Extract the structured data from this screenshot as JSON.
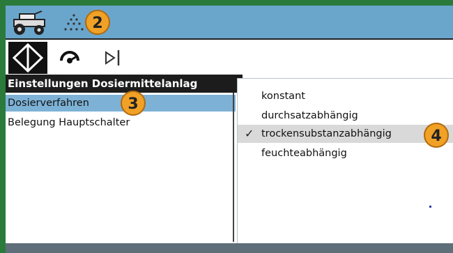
{
  "callouts": {
    "c2": "2",
    "c3": "3",
    "c4": "4"
  },
  "menu": {
    "title": "Einstellungen Dosiermittelanlag",
    "items": [
      {
        "label": "Dosierverfahren",
        "selected": true
      },
      {
        "label": "Belegung Hauptschalter",
        "selected": false
      }
    ]
  },
  "dropdown": {
    "options": [
      {
        "label": "konstant",
        "checked": false
      },
      {
        "label": "durchsatzabhängig",
        "checked": false
      },
      {
        "label": "trockensubstanzabhängig",
        "checked": true
      },
      {
        "label": "feuchteabhängig",
        "checked": false
      }
    ],
    "check_glyph": "✓"
  },
  "icons": {
    "titlebar": [
      "tractor-icon",
      "spray-icon"
    ],
    "toolbar": [
      "navigation-diamond-icon",
      "gauge-icon",
      "step-forward-icon"
    ]
  },
  "colors": {
    "outer_border": "#2a7a3b",
    "titlebar": "#6aa6cc",
    "selection": "#7db2d6",
    "callout": "#f0a126"
  }
}
